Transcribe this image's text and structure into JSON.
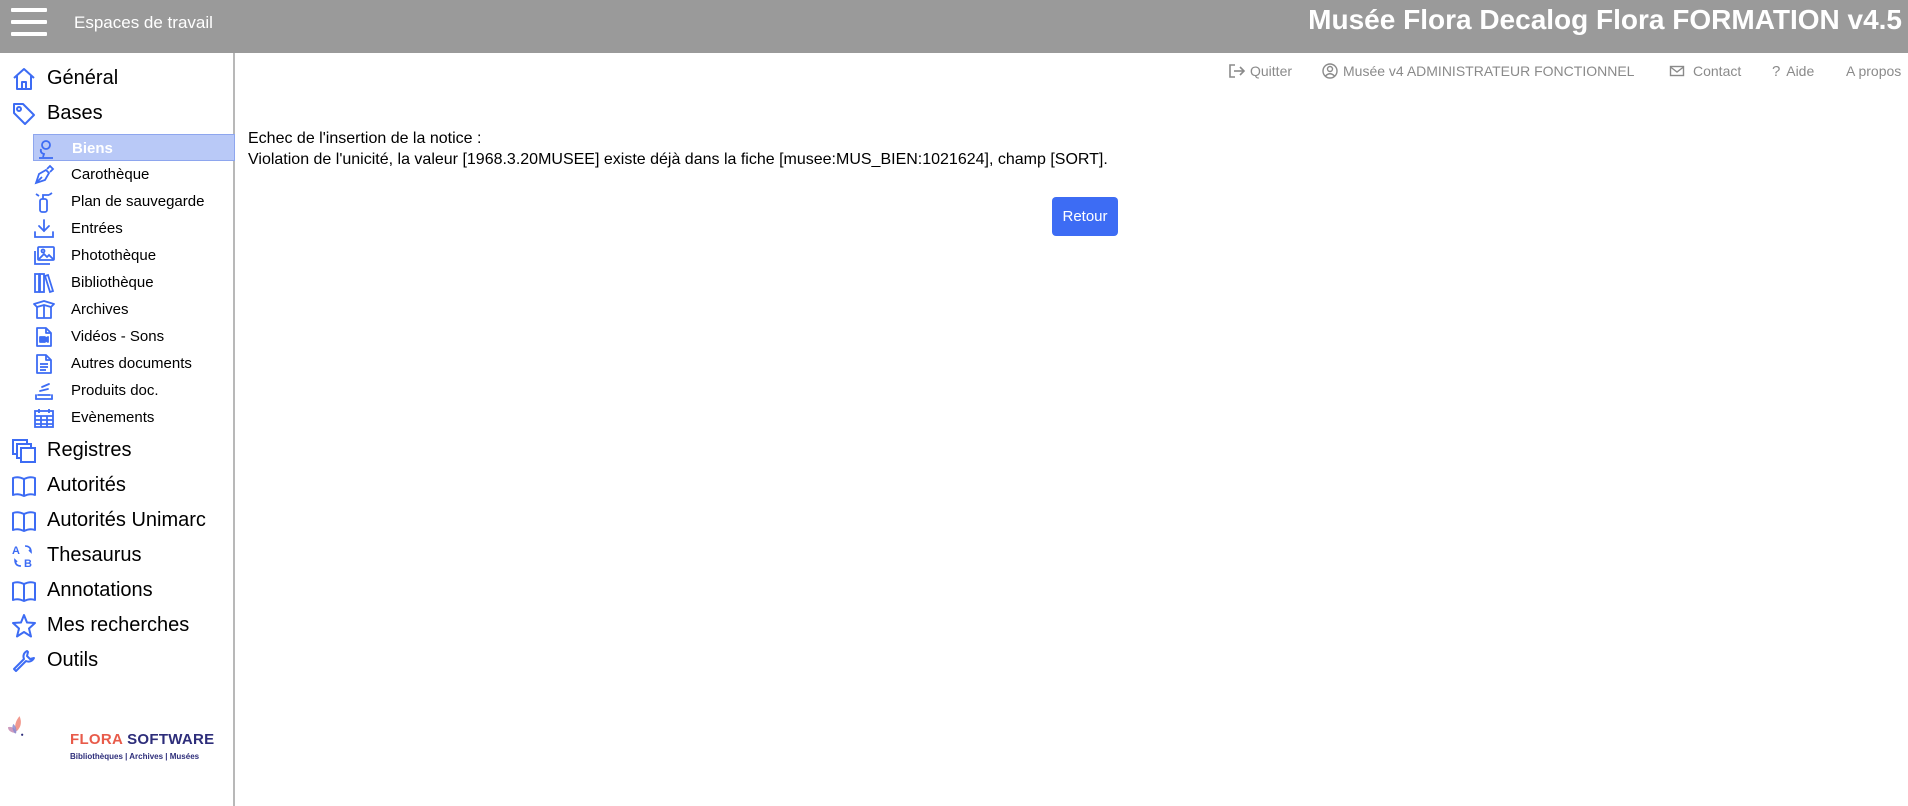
{
  "header": {
    "workspaces_label": "Espaces de travail",
    "app_title": "Musée Flora Decalog Flora FORMATION v4.5",
    "bg_color": "#9a9a9a"
  },
  "top_links": {
    "quit": "Quitter",
    "user": "Musée v4 ADMINISTRATEUR FONCTIONNEL",
    "contact": "Contact",
    "help": "Aide",
    "about": "A propos"
  },
  "sidebar": {
    "items": [
      {
        "label": "Général",
        "icon": "home-icon"
      },
      {
        "label": "Bases",
        "icon": "tag-icon"
      },
      {
        "label": "Registres",
        "icon": "copy-icon"
      },
      {
        "label": "Autorités",
        "icon": "book-open-icon"
      },
      {
        "label": "Autorités Unimarc",
        "icon": "book-open-icon"
      },
      {
        "label": "Thesaurus",
        "icon": "sort-alpha-icon"
      },
      {
        "label": "Annotations",
        "icon": "book-open-icon"
      },
      {
        "label": "Mes recherches",
        "icon": "star-icon"
      },
      {
        "label": "Outils",
        "icon": "wrench-icon"
      }
    ],
    "bases_items": [
      {
        "label": "Biens",
        "icon": "bust-icon",
        "active": true
      },
      {
        "label": "Carothèque",
        "icon": "pen-nib-icon"
      },
      {
        "label": "Plan de sauvegarde",
        "icon": "fire-extinguisher-icon"
      },
      {
        "label": "Entrées",
        "icon": "download-icon"
      },
      {
        "label": "Photothèque",
        "icon": "images-icon"
      },
      {
        "label": "Bibliothèque",
        "icon": "books-icon"
      },
      {
        "label": "Archives",
        "icon": "box-open-icon"
      },
      {
        "label": "Vidéos - Sons",
        "icon": "file-video-icon"
      },
      {
        "label": "Autres documents",
        "icon": "file-text-icon"
      },
      {
        "label": "Produits doc.",
        "icon": "layer-stack-icon"
      },
      {
        "label": "Evènements",
        "icon": "calendar-icon"
      }
    ],
    "accent_color": "#3d6cf4"
  },
  "logo": {
    "name_part1": "FLORA",
    "name_part2": "SOFTWARE",
    "tagline": "Bibliothèques | Archives | Musées"
  },
  "main": {
    "error_title": "Echec de l'insertion de la notice :",
    "error_detail": "Violation de l'unicité, la valeur [1968.3.20MUSEE] existe déjà dans la fiche [musee:MUS_BIEN:1021624], champ [SORT].",
    "back_button": "Retour"
  }
}
